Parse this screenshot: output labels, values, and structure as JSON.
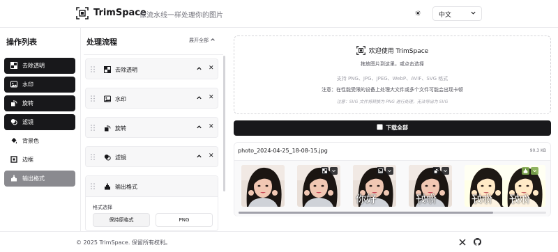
{
  "header": {
    "brand": "TrimSpace",
    "tagline": "像流水线一样处理你的图片",
    "language": "中文"
  },
  "operations": {
    "title": "操作列表",
    "items": [
      {
        "label": "去除透明",
        "icon": "transparency-icon",
        "state": "active"
      },
      {
        "label": "水印",
        "icon": "image-icon",
        "state": "active"
      },
      {
        "label": "旋转",
        "icon": "rotate-icon",
        "state": "active"
      },
      {
        "label": "滤镜",
        "icon": "filter-icon",
        "state": "active"
      },
      {
        "label": "背景色",
        "icon": "paint-bucket-icon",
        "state": "inactive"
      },
      {
        "label": "边框",
        "icon": "border-icon",
        "state": "inactive"
      },
      {
        "label": "输出格式",
        "icon": "output-format-icon",
        "state": "disabled"
      }
    ]
  },
  "pipeline": {
    "title": "处理流程",
    "expand_all": "展开全部",
    "steps": [
      {
        "label": "去除透明",
        "icon": "transparency-icon"
      },
      {
        "label": "水印",
        "icon": "image-icon"
      },
      {
        "label": "旋转",
        "icon": "rotate-icon"
      },
      {
        "label": "滤镜",
        "icon": "filter-icon"
      }
    ],
    "output": {
      "label": "输出格式",
      "format_label": "格式选择",
      "keep_format": "保持原格式",
      "png": "PNG"
    }
  },
  "dropzone": {
    "welcome": "欢迎使用 TrimSpace",
    "drag_hint": "拖放图片到这里，或点击选择",
    "supported": "支持 PNG、JPG、JPEG、WebP、AVIF、SVG 格式",
    "warning": "注意：在性能受限的设备上处理大文件或多个文件可能会出现卡顿",
    "svg_note": "注意：SVG 文件将转换为 PNG 进行处理，无法导出为 SVG"
  },
  "download_all": "下载全部",
  "file": {
    "name": "photo_2024-04-25_18-08-15.jpg",
    "size": "90.3 KB",
    "watermark_text": "你好",
    "thumbnails": [
      {
        "step": "original",
        "badges": []
      },
      {
        "step": "remove-transparency",
        "badges": [
          "transparency-icon",
          "download-icon"
        ]
      },
      {
        "step": "watermark",
        "badges": [
          "image-icon",
          "download-icon"
        ]
      },
      {
        "step": "rotate",
        "badges": [
          "rotate-icon",
          "download-icon"
        ]
      },
      {
        "step": "filter",
        "badges": []
      },
      {
        "step": "output",
        "badges": [
          "output-format-icon",
          "download-icon"
        ]
      }
    ]
  },
  "footer": {
    "copyright": "© 2025 TrimSpace. 保留所有权利。"
  },
  "colors": {
    "dark": "#18181b",
    "disabled": "#8a8a8f",
    "border": "#ececef"
  }
}
